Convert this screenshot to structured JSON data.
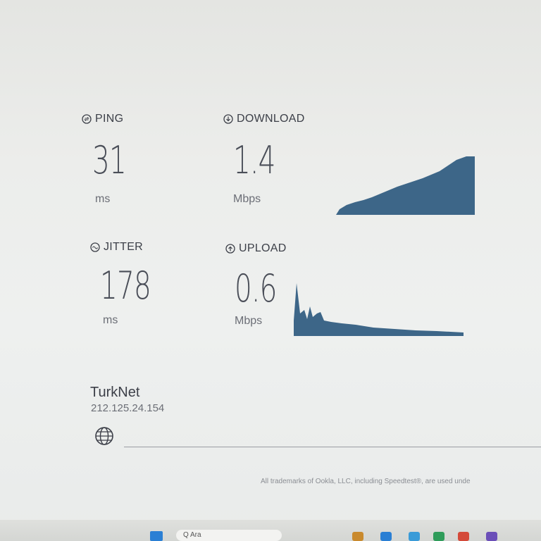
{
  "metrics": {
    "ping": {
      "label": "PING",
      "value": "31",
      "unit": "ms",
      "icon": "ping-icon"
    },
    "download": {
      "label": "DOWNLOAD",
      "value": "1.4",
      "unit": "Mbps",
      "icon": "download-arrow-icon"
    },
    "jitter": {
      "label": "JITTER",
      "value": "178",
      "unit": "ms",
      "icon": "jitter-icon"
    },
    "upload": {
      "label": "UPLOAD",
      "value": "0.6",
      "unit": "Mbps",
      "icon": "upload-arrow-icon"
    }
  },
  "isp": {
    "name": "TurkNet",
    "ip": "212.125.24.154",
    "icon": "globe-icon"
  },
  "footer": {
    "text": "All trademarks of Ookla, LLC, including Speedtest®, are used unde"
  },
  "colors": {
    "graph_fill": "#3d6688",
    "text": "#3c3f48"
  },
  "taskbar": {
    "search_text": "Q Ara"
  }
}
